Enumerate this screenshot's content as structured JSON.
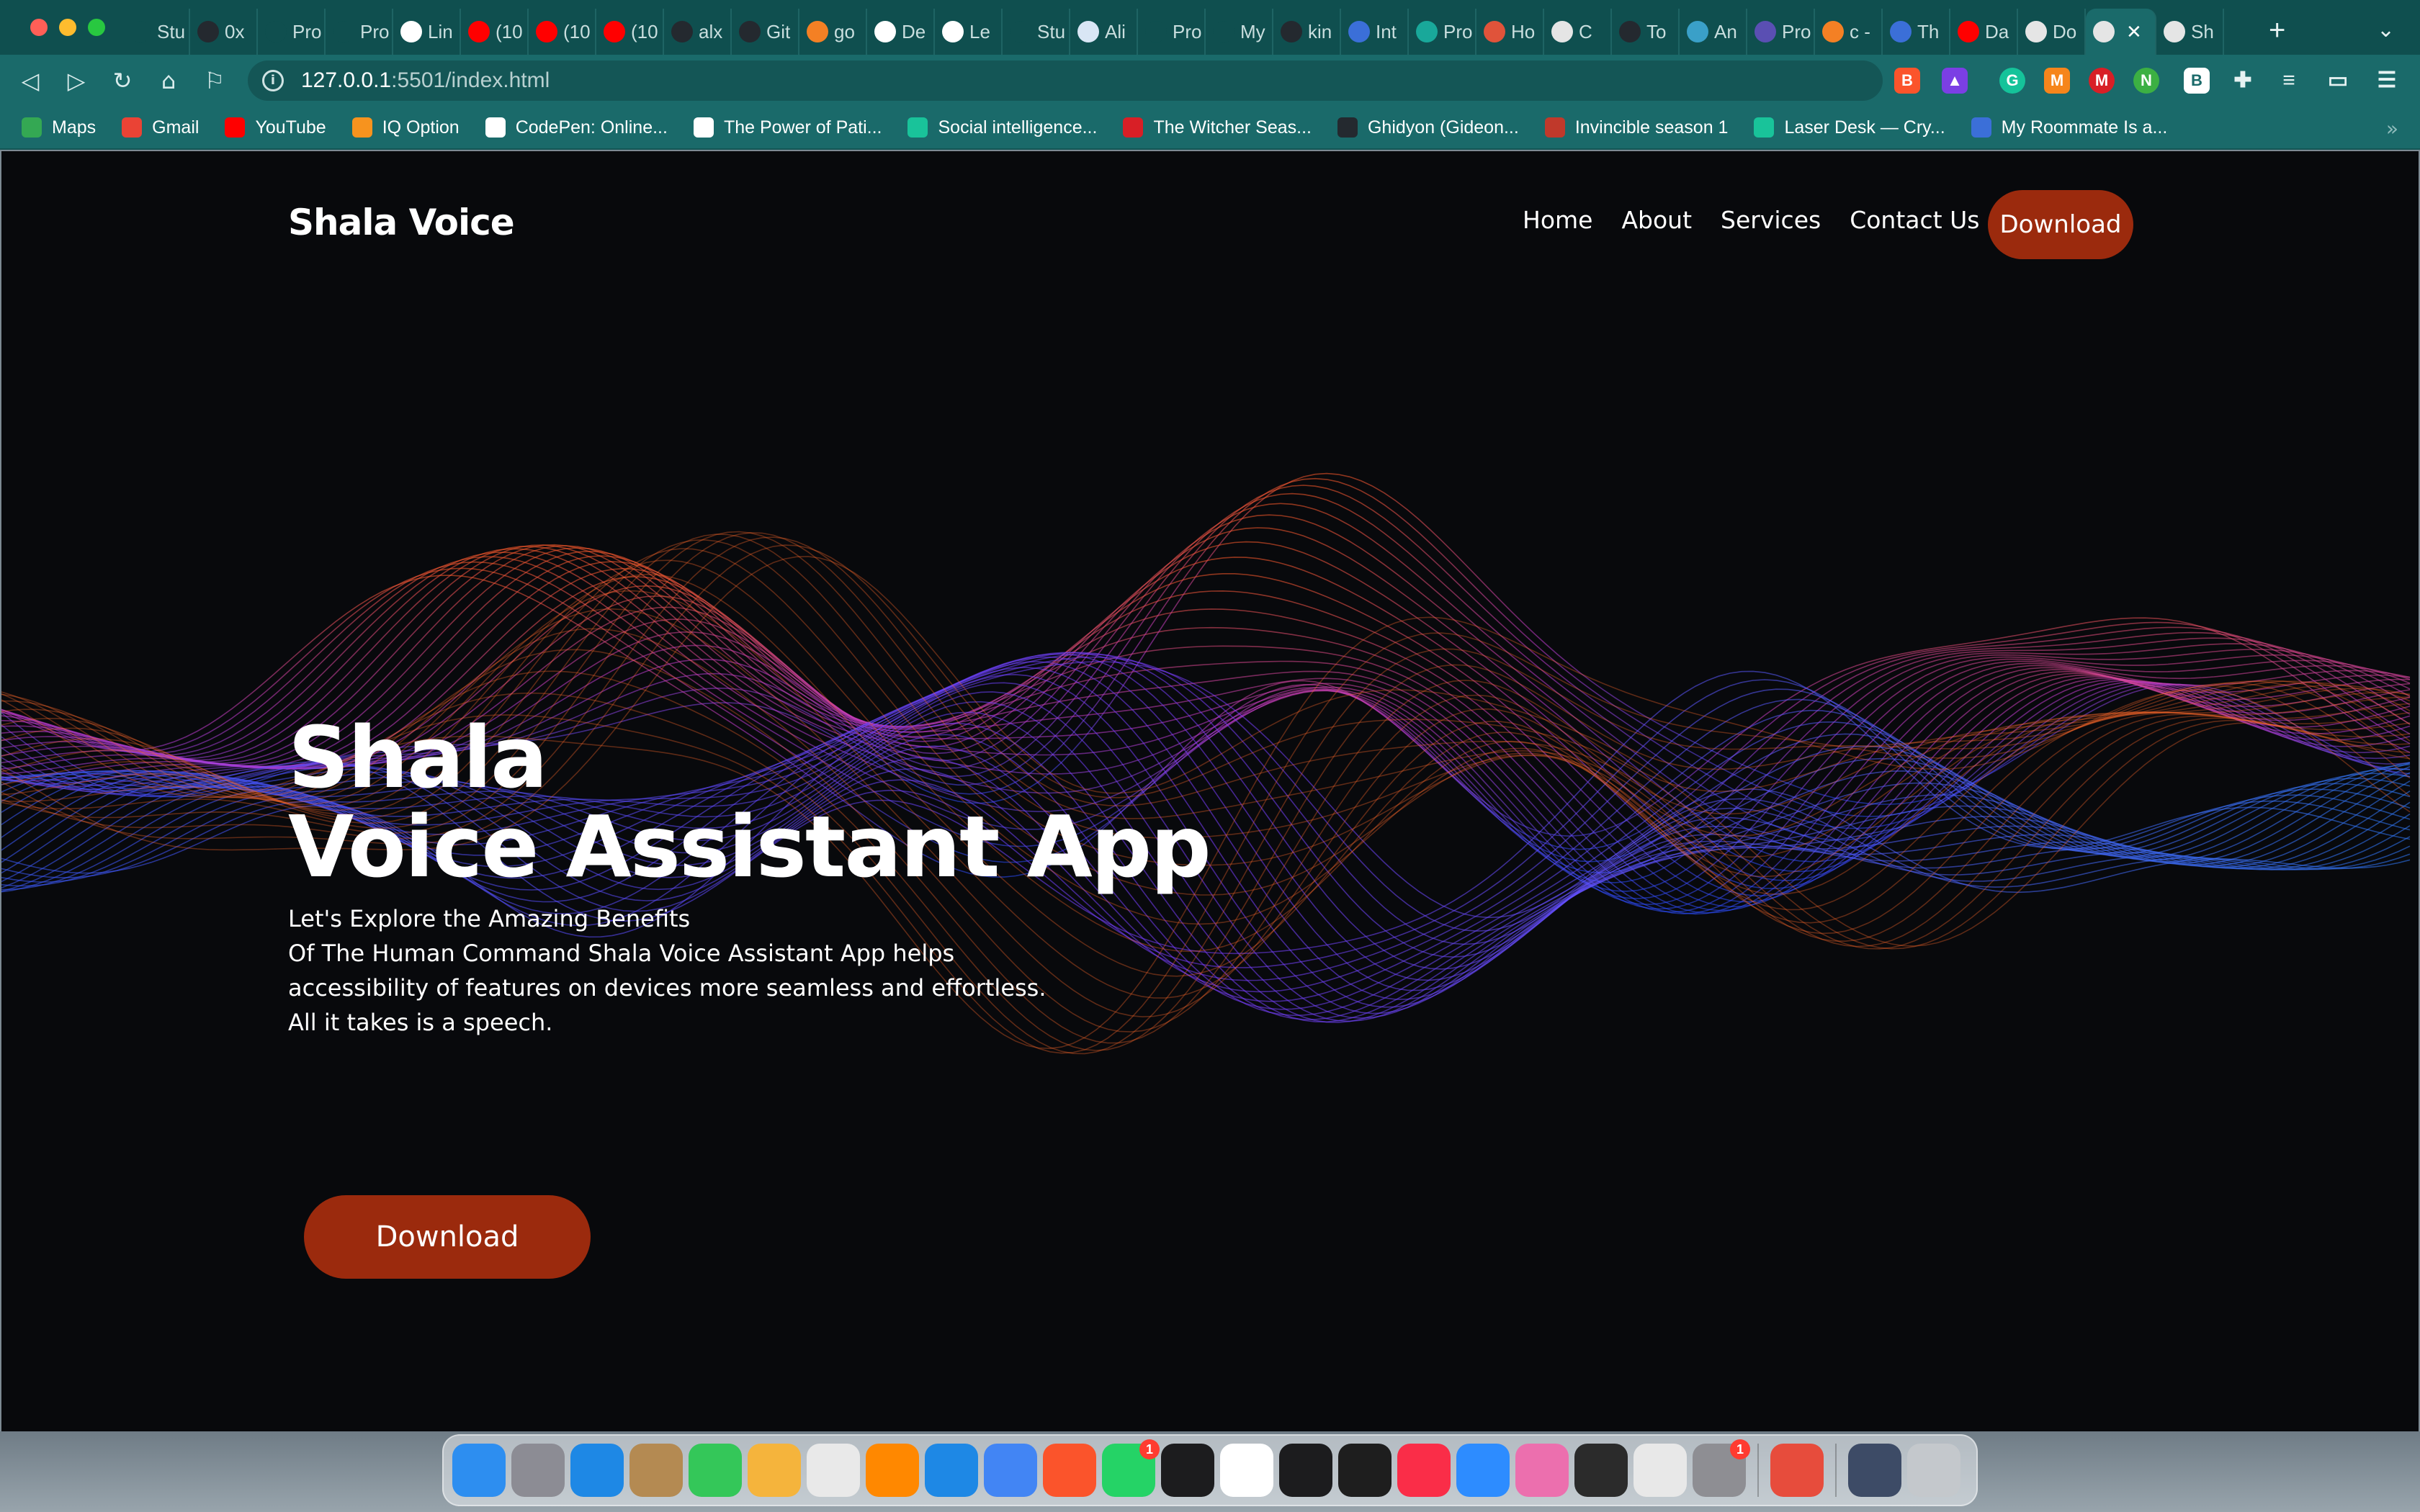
{
  "browser": {
    "tabs": [
      {
        "label": "Stu",
        "icon": "alx-icon",
        "color": "#0f4f4f"
      },
      {
        "label": "0x",
        "icon": "github-icon",
        "color": "#24292f"
      },
      {
        "label": "Pro",
        "icon": "alx-icon",
        "color": "#0f4f4f"
      },
      {
        "label": "Pro",
        "icon": "alx-icon",
        "color": "#0f4f4f"
      },
      {
        "label": "Lin",
        "icon": "page-icon",
        "color": "#ffffff"
      },
      {
        "label": "(10",
        "icon": "youtube-icon",
        "color": "#ff0000"
      },
      {
        "label": "(10",
        "icon": "youtube-icon",
        "color": "#ff0000"
      },
      {
        "label": "(10",
        "icon": "youtube-icon",
        "color": "#ff0000"
      },
      {
        "label": "alx",
        "icon": "github-icon",
        "color": "#24292f"
      },
      {
        "label": "Git",
        "icon": "github-icon",
        "color": "#24292f"
      },
      {
        "label": "go",
        "icon": "stackoverflow-icon",
        "color": "#f48024"
      },
      {
        "label": "De",
        "icon": "wikipedia-icon",
        "color": "#ffffff"
      },
      {
        "label": "Le",
        "icon": "page-icon",
        "color": "#ffffff"
      },
      {
        "label": "Stu",
        "icon": "alx-icon",
        "color": "#0f4f4f"
      },
      {
        "label": "Ali",
        "icon": "page-icon",
        "color": "#d9e6f5"
      },
      {
        "label": "Pro",
        "icon": "alx-icon",
        "color": "#0f4f4f"
      },
      {
        "label": "My",
        "icon": "alx-icon",
        "color": "#0f4f4f"
      },
      {
        "label": "kin",
        "icon": "github-icon",
        "color": "#24292f"
      },
      {
        "label": "Int",
        "icon": "page-icon",
        "color": "#3b6fd8"
      },
      {
        "label": "Pro",
        "icon": "slash-icon",
        "color": "#19a89a"
      },
      {
        "label": "Ho",
        "icon": "diamond-icon",
        "color": "#e0533a"
      },
      {
        "label": "C",
        "icon": "gear-icon",
        "color": "#e5e5e5"
      },
      {
        "label": "To",
        "icon": "github-icon",
        "color": "#24292f"
      },
      {
        "label": "An",
        "icon": "s-icon",
        "color": "#3aa0c8"
      },
      {
        "label": "Pro",
        "icon": "st-icon",
        "color": "#5a4fb3"
      },
      {
        "label": "c -",
        "icon": "stackoverflow-icon",
        "color": "#f48024"
      },
      {
        "label": "Th",
        "icon": "page-icon",
        "color": "#3b6fd8"
      },
      {
        "label": "Da",
        "icon": "youtube-icon",
        "color": "#ff0000"
      },
      {
        "label": "Do",
        "icon": "globe-icon",
        "color": "#e5e5e5"
      },
      {
        "label": "",
        "icon": "globe-icon",
        "color": "#e5e5e5",
        "active": true
      },
      {
        "label": "Sh",
        "icon": "globe-icon",
        "color": "#e5e5e5"
      }
    ],
    "url_host": "127.0.0.1",
    "url_rest": ":5501/index.html",
    "bookmarks": [
      {
        "label": "Maps",
        "color": "#34a853"
      },
      {
        "label": "Gmail",
        "color": "#ea4335"
      },
      {
        "label": "YouTube",
        "color": "#ff0000"
      },
      {
        "label": "IQ Option",
        "color": "#f7931e"
      },
      {
        "label": "CodePen: Online...",
        "color": "#ffffff"
      },
      {
        "label": "The Power of Pati...",
        "color": "#ffffff"
      },
      {
        "label": "Social intelligence...",
        "color": "#19c39a"
      },
      {
        "label": "The Witcher Seas...",
        "color": "#d81f26"
      },
      {
        "label": "Ghidyon (Gideon...",
        "color": "#24292f"
      },
      {
        "label": "Invincible season 1",
        "color": "#c0392b"
      },
      {
        "label": "Laser Desk — Cry...",
        "color": "#19c39a"
      },
      {
        "label": "My Roommate Is a...",
        "color": "#3b6fd8"
      }
    ]
  },
  "site": {
    "brand": "Shala Voice",
    "menu": [
      "Home",
      "About",
      "Services",
      "Contact Us"
    ],
    "nav_download": "Download",
    "hero_title_line1": "Shala",
    "hero_title_line2": "Voice Assistant App",
    "hero_text": [
      "Let's Explore the Amazing Benefits",
      "Of The Human Command Shala Voice Assistant App helps",
      "accessibility of features on devices more seamless and effortless.",
      "All it takes is a speech."
    ],
    "hero_download": "Download",
    "accent_color": "#9b2a0d"
  },
  "dock": {
    "apps": [
      {
        "name": "finder-icon",
        "color": "#2d8ef0"
      },
      {
        "name": "launchpad-icon",
        "color": "#8c8c94"
      },
      {
        "name": "safari-icon",
        "color": "#1e88e5"
      },
      {
        "name": "contacts-icon",
        "color": "#b48a52"
      },
      {
        "name": "messages-icon",
        "color": "#34c759"
      },
      {
        "name": "photos-icon",
        "color": "#f5b43c"
      },
      {
        "name": "textedit-icon",
        "color": "#e9e9e9"
      },
      {
        "name": "vlc-icon",
        "color": "#ff8800"
      },
      {
        "name": "vscode-icon",
        "color": "#1e88e5"
      },
      {
        "name": "chrome-icon",
        "color": "#4285f4"
      },
      {
        "name": "brave-icon",
        "color": "#fb542b"
      },
      {
        "name": "whatsapp-icon",
        "color": "#25d366",
        "badge": "1"
      },
      {
        "name": "terminal-dark-icon",
        "color": "#1c1c1e"
      },
      {
        "name": "slack-icon",
        "color": "#ffffff"
      },
      {
        "name": "activity-monitor-icon",
        "color": "#1c1c1e"
      },
      {
        "name": "figma-icon",
        "color": "#1e1e1e"
      },
      {
        "name": "music-icon",
        "color": "#fa2d48"
      },
      {
        "name": "zoom-icon",
        "color": "#2d8cff"
      },
      {
        "name": "cleanmymac-icon",
        "color": "#ec6fae"
      },
      {
        "name": "terminal-icon",
        "color": "#2b2b2b"
      },
      {
        "name": "preview-icon",
        "color": "#e8e8e8"
      },
      {
        "name": "system-settings-icon",
        "color": "#8e8e93",
        "badge": "1"
      },
      {
        "name": "compass-icon",
        "color": "#e74c3c"
      },
      {
        "name": "downloads-icon",
        "color": "#3d4b66"
      },
      {
        "name": "trash-icon",
        "color": "#c4c8cc"
      }
    ]
  }
}
